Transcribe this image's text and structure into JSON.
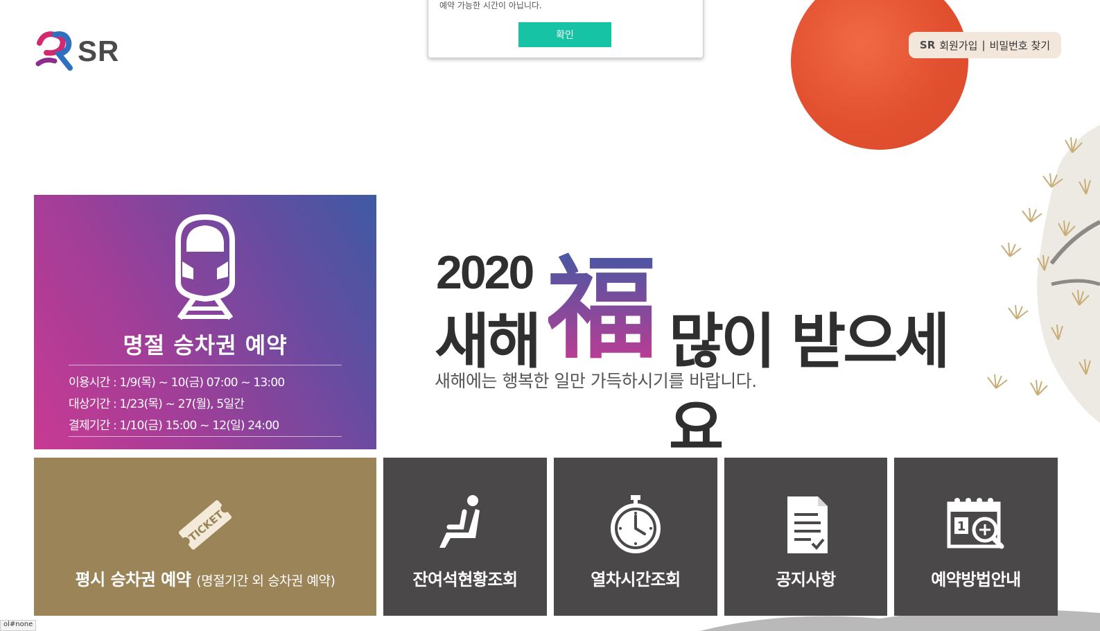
{
  "dialog": {
    "message": "예약 가능한 시간이 아닙니다.",
    "ok_label": "확인"
  },
  "header": {
    "logo_text": "SR",
    "top_links": {
      "sr_mark": "SR",
      "signup": "회원가입",
      "separator": "|",
      "find_password": "비밀번호 찾기"
    }
  },
  "promo": {
    "title": "명절 승차권 예약",
    "lines": [
      "이용시간 : 1/9(목) ~ 10(금) 07:00 ~ 13:00",
      "대상기간 : 1/23(목) ~ 27(월), 5일간",
      "결제기간 : 1/10(금) 15:00 ~ 12(일) 24:00"
    ]
  },
  "banner": {
    "year": "2020",
    "word1": "새해",
    "bok": "福",
    "word2": "많이 받으세요",
    "subtitle": "새해에는 행복한 일만 가득하시기를 바랍니다."
  },
  "tiles": {
    "regular": {
      "label": "평시 승차권 예약",
      "sub": "(명절기간 외 승차권 예약)",
      "ticket_text": "TICKET"
    },
    "seats": {
      "label": "잔여석현황조회"
    },
    "timetable": {
      "label": "열차시간조회"
    },
    "notice": {
      "label": "공지사항"
    },
    "guide": {
      "label": "예약방법안내"
    }
  },
  "status_bar": {
    "url": "ol#none"
  },
  "colors": {
    "ok_button": "#16c3a5",
    "sun": "#e2502f",
    "regular_tile": "#9a8458",
    "dark_tile": "#4a4849",
    "bok_gradient": [
      "#3f5aa4",
      "#c83a92"
    ]
  }
}
